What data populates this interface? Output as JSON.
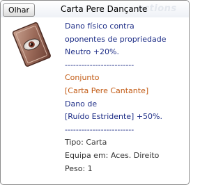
{
  "header": {
    "olhar_label": "Olhar",
    "title": "Carta Pere Dançante",
    "watermark": "ections"
  },
  "item": {
    "icon": "card-with-eye-icon",
    "description_lines": [
      "Dano físico contra",
      "oponentes de propriedade",
      "Neutro +20%."
    ],
    "separator": "-------------------------",
    "set": {
      "label": "Conjunto",
      "card": "[Carta Pere Cantante]"
    },
    "set_bonus_lines": [
      "Dano de",
      "[Ruído Estridente] +50%."
    ],
    "separator2": "-------------------------",
    "stats": {
      "tipo": "Tipo: Carta",
      "equipa": "Equipa em: Aces. Direito",
      "peso": "Peso: 1"
    }
  },
  "colors": {
    "description": "#1c2c86",
    "set": "#c25a13",
    "stats": "#333333"
  }
}
